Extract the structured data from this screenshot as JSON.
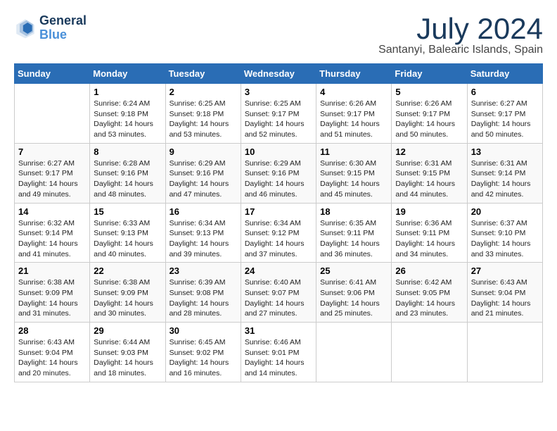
{
  "logo": {
    "line1": "General",
    "line2": "Blue"
  },
  "title": "July 2024",
  "subtitle": "Santanyi, Balearic Islands, Spain",
  "days_of_week": [
    "Sunday",
    "Monday",
    "Tuesday",
    "Wednesday",
    "Thursday",
    "Friday",
    "Saturday"
  ],
  "weeks": [
    [
      {
        "day": "",
        "sunrise": "",
        "sunset": "",
        "daylight": ""
      },
      {
        "day": "1",
        "sunrise": "Sunrise: 6:24 AM",
        "sunset": "Sunset: 9:18 PM",
        "daylight": "Daylight: 14 hours and 53 minutes."
      },
      {
        "day": "2",
        "sunrise": "Sunrise: 6:25 AM",
        "sunset": "Sunset: 9:18 PM",
        "daylight": "Daylight: 14 hours and 53 minutes."
      },
      {
        "day": "3",
        "sunrise": "Sunrise: 6:25 AM",
        "sunset": "Sunset: 9:17 PM",
        "daylight": "Daylight: 14 hours and 52 minutes."
      },
      {
        "day": "4",
        "sunrise": "Sunrise: 6:26 AM",
        "sunset": "Sunset: 9:17 PM",
        "daylight": "Daylight: 14 hours and 51 minutes."
      },
      {
        "day": "5",
        "sunrise": "Sunrise: 6:26 AM",
        "sunset": "Sunset: 9:17 PM",
        "daylight": "Daylight: 14 hours and 50 minutes."
      },
      {
        "day": "6",
        "sunrise": "Sunrise: 6:27 AM",
        "sunset": "Sunset: 9:17 PM",
        "daylight": "Daylight: 14 hours and 50 minutes."
      }
    ],
    [
      {
        "day": "7",
        "sunrise": "Sunrise: 6:27 AM",
        "sunset": "Sunset: 9:17 PM",
        "daylight": "Daylight: 14 hours and 49 minutes."
      },
      {
        "day": "8",
        "sunrise": "Sunrise: 6:28 AM",
        "sunset": "Sunset: 9:16 PM",
        "daylight": "Daylight: 14 hours and 48 minutes."
      },
      {
        "day": "9",
        "sunrise": "Sunrise: 6:29 AM",
        "sunset": "Sunset: 9:16 PM",
        "daylight": "Daylight: 14 hours and 47 minutes."
      },
      {
        "day": "10",
        "sunrise": "Sunrise: 6:29 AM",
        "sunset": "Sunset: 9:16 PM",
        "daylight": "Daylight: 14 hours and 46 minutes."
      },
      {
        "day": "11",
        "sunrise": "Sunrise: 6:30 AM",
        "sunset": "Sunset: 9:15 PM",
        "daylight": "Daylight: 14 hours and 45 minutes."
      },
      {
        "day": "12",
        "sunrise": "Sunrise: 6:31 AM",
        "sunset": "Sunset: 9:15 PM",
        "daylight": "Daylight: 14 hours and 44 minutes."
      },
      {
        "day": "13",
        "sunrise": "Sunrise: 6:31 AM",
        "sunset": "Sunset: 9:14 PM",
        "daylight": "Daylight: 14 hours and 42 minutes."
      }
    ],
    [
      {
        "day": "14",
        "sunrise": "Sunrise: 6:32 AM",
        "sunset": "Sunset: 9:14 PM",
        "daylight": "Daylight: 14 hours and 41 minutes."
      },
      {
        "day": "15",
        "sunrise": "Sunrise: 6:33 AM",
        "sunset": "Sunset: 9:13 PM",
        "daylight": "Daylight: 14 hours and 40 minutes."
      },
      {
        "day": "16",
        "sunrise": "Sunrise: 6:34 AM",
        "sunset": "Sunset: 9:13 PM",
        "daylight": "Daylight: 14 hours and 39 minutes."
      },
      {
        "day": "17",
        "sunrise": "Sunrise: 6:34 AM",
        "sunset": "Sunset: 9:12 PM",
        "daylight": "Daylight: 14 hours and 37 minutes."
      },
      {
        "day": "18",
        "sunrise": "Sunrise: 6:35 AM",
        "sunset": "Sunset: 9:11 PM",
        "daylight": "Daylight: 14 hours and 36 minutes."
      },
      {
        "day": "19",
        "sunrise": "Sunrise: 6:36 AM",
        "sunset": "Sunset: 9:11 PM",
        "daylight": "Daylight: 14 hours and 34 minutes."
      },
      {
        "day": "20",
        "sunrise": "Sunrise: 6:37 AM",
        "sunset": "Sunset: 9:10 PM",
        "daylight": "Daylight: 14 hours and 33 minutes."
      }
    ],
    [
      {
        "day": "21",
        "sunrise": "Sunrise: 6:38 AM",
        "sunset": "Sunset: 9:09 PM",
        "daylight": "Daylight: 14 hours and 31 minutes."
      },
      {
        "day": "22",
        "sunrise": "Sunrise: 6:38 AM",
        "sunset": "Sunset: 9:09 PM",
        "daylight": "Daylight: 14 hours and 30 minutes."
      },
      {
        "day": "23",
        "sunrise": "Sunrise: 6:39 AM",
        "sunset": "Sunset: 9:08 PM",
        "daylight": "Daylight: 14 hours and 28 minutes."
      },
      {
        "day": "24",
        "sunrise": "Sunrise: 6:40 AM",
        "sunset": "Sunset: 9:07 PM",
        "daylight": "Daylight: 14 hours and 27 minutes."
      },
      {
        "day": "25",
        "sunrise": "Sunrise: 6:41 AM",
        "sunset": "Sunset: 9:06 PM",
        "daylight": "Daylight: 14 hours and 25 minutes."
      },
      {
        "day": "26",
        "sunrise": "Sunrise: 6:42 AM",
        "sunset": "Sunset: 9:05 PM",
        "daylight": "Daylight: 14 hours and 23 minutes."
      },
      {
        "day": "27",
        "sunrise": "Sunrise: 6:43 AM",
        "sunset": "Sunset: 9:04 PM",
        "daylight": "Daylight: 14 hours and 21 minutes."
      }
    ],
    [
      {
        "day": "28",
        "sunrise": "Sunrise: 6:43 AM",
        "sunset": "Sunset: 9:04 PM",
        "daylight": "Daylight: 14 hours and 20 minutes."
      },
      {
        "day": "29",
        "sunrise": "Sunrise: 6:44 AM",
        "sunset": "Sunset: 9:03 PM",
        "daylight": "Daylight: 14 hours and 18 minutes."
      },
      {
        "day": "30",
        "sunrise": "Sunrise: 6:45 AM",
        "sunset": "Sunset: 9:02 PM",
        "daylight": "Daylight: 14 hours and 16 minutes."
      },
      {
        "day": "31",
        "sunrise": "Sunrise: 6:46 AM",
        "sunset": "Sunset: 9:01 PM",
        "daylight": "Daylight: 14 hours and 14 minutes."
      },
      {
        "day": "",
        "sunrise": "",
        "sunset": "",
        "daylight": ""
      },
      {
        "day": "",
        "sunrise": "",
        "sunset": "",
        "daylight": ""
      },
      {
        "day": "",
        "sunrise": "",
        "sunset": "",
        "daylight": ""
      }
    ]
  ]
}
